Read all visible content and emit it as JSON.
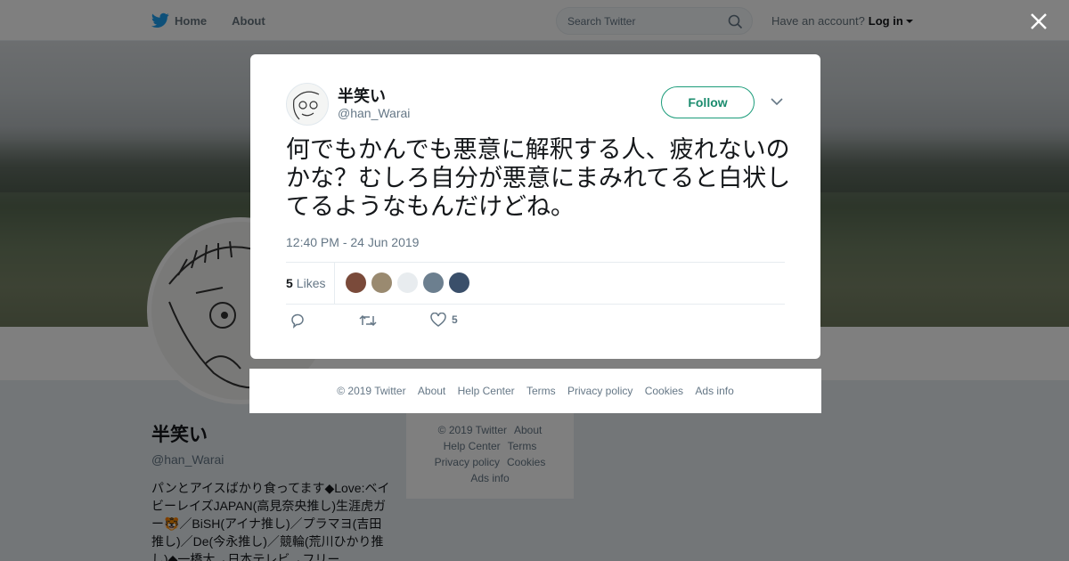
{
  "topnav": {
    "home_label": "Home",
    "about_label": "About",
    "search_placeholder": "Search Twitter",
    "account_prompt": "Have an account?",
    "login_label": "Log in"
  },
  "profile": {
    "name": "半笑い",
    "handle": "@han_Warai",
    "bio": "パンとアイスばかり食ってます◆Love:ベイビーレイズJAPAN(高見奈央推し)生涯虎ガー🐯／BiSH(アイナ推し)／プラマヨ(吉田推し)／De(今永推し)／競輪(荒川ひかり推し)◆一橋大→日本テレビ→フリー"
  },
  "side_footer": [
    "© 2019 Twitter",
    "About",
    "Help Center",
    "Terms",
    "Privacy policy",
    "Cookies",
    "Ads info"
  ],
  "tweet": {
    "name": "半笑い",
    "handle": "@han_Warai",
    "follow_label": "Follow",
    "text": "何でもかんでも悪意に解釈する人、疲れないのかな？むしろ自分が悪意にまみれてると白状してるようなもんだけどね。",
    "timestamp": "12:40 PM - 24 Jun 2019",
    "likes_count": "5",
    "likes_label": "Likes",
    "like_action_count": "5",
    "liker_colors": [
      "#7a4a3a",
      "#9a8a70",
      "#e8ecef",
      "#6c7f8f",
      "#3a4f6a"
    ]
  },
  "modal_footer": [
    "© 2019 Twitter",
    "About",
    "Help Center",
    "Terms",
    "Privacy policy",
    "Cookies",
    "Ads info"
  ],
  "colors": {
    "brand": "#1da1f2",
    "follow_accent": "#1b9c7a",
    "overlay": "rgba(0,0,0,0.5)"
  }
}
